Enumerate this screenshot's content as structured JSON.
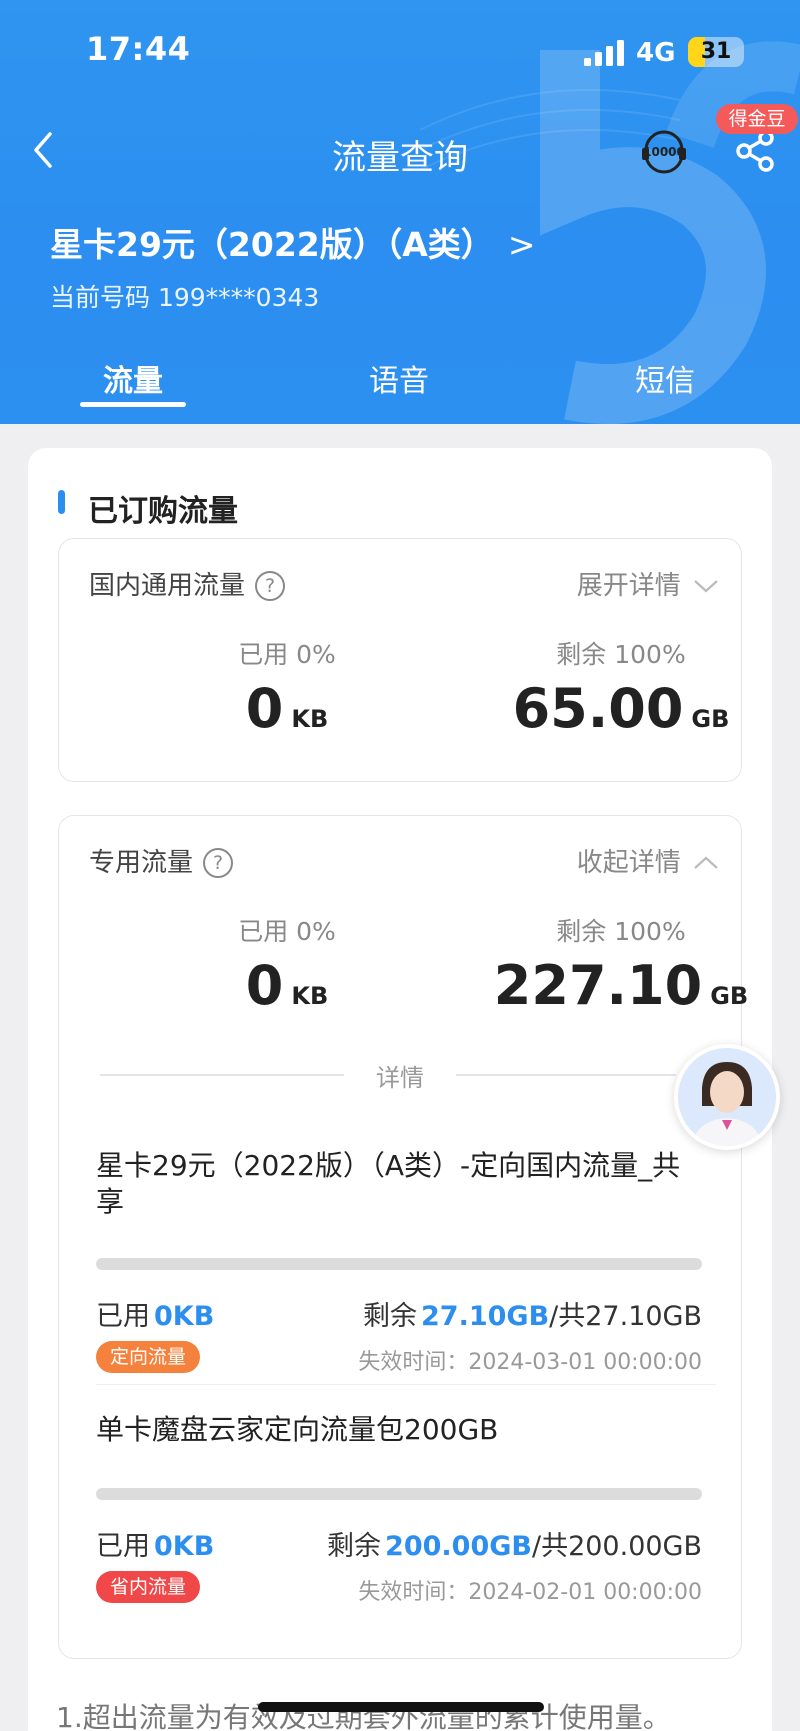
{
  "status_bar": {
    "time": "17:44",
    "network": "4G",
    "battery": "31",
    "battery_level": 0.31
  },
  "nav": {
    "title": "流量查询",
    "support_icon_text": "10000",
    "gold_badge": "得金豆"
  },
  "plan": {
    "name": "星卡29元（2022版）（A类）",
    "chevron": ">",
    "phone": "当前号码 199****0343"
  },
  "tabs": [
    {
      "label": "流量",
      "active": true
    },
    {
      "label": "语音",
      "active": false
    },
    {
      "label": "短信",
      "active": false
    }
  ],
  "section": {
    "title": "已订购流量"
  },
  "domestic": {
    "label": "国内通用流量",
    "help": "?",
    "toggle": "展开详情",
    "used_label": "已用 0%",
    "used_num": "0",
    "used_unit": "KB",
    "remain_label": "剩余 100%",
    "remain_num": "65.00",
    "remain_unit": "GB"
  },
  "dedicated": {
    "label": "专用流量",
    "help": "?",
    "toggle": "收起详情",
    "used_label": "已用 0%",
    "used_num": "0",
    "used_unit": "KB",
    "remain_label": "剩余 100%",
    "remain_num": "227.10",
    "remain_unit": "GB",
    "divider": "详情",
    "items": [
      {
        "name": "星卡29元（2022版）（A类）-定向国内流量_共享",
        "used_prefix": "已用",
        "used_value": "0KB",
        "remain_prefix": "剩余",
        "remain_value": "27.10GB",
        "total": "/共27.10GB",
        "tag": "定向流量",
        "expire": "失效时间：2024-03-01 00:00:00",
        "used_fraction": 0
      },
      {
        "name": "单卡魔盘云家定向流量包200GB",
        "used_prefix": "已用",
        "used_value": "0KB",
        "remain_prefix": "剩余",
        "remain_value": "200.00GB",
        "total": "/共200.00GB",
        "tag": "省内流量",
        "expire": "失效时间：2024-02-01 00:00:00",
        "used_fraction": 0
      }
    ]
  },
  "footer": {
    "note": "1.超出流量为有效及过期套外流量的累计使用量。"
  },
  "colors": {
    "primary": "#2c8ff0",
    "tag_orange": "#f5823c",
    "tag_red": "#f04848",
    "badge": "#f45a5a"
  }
}
